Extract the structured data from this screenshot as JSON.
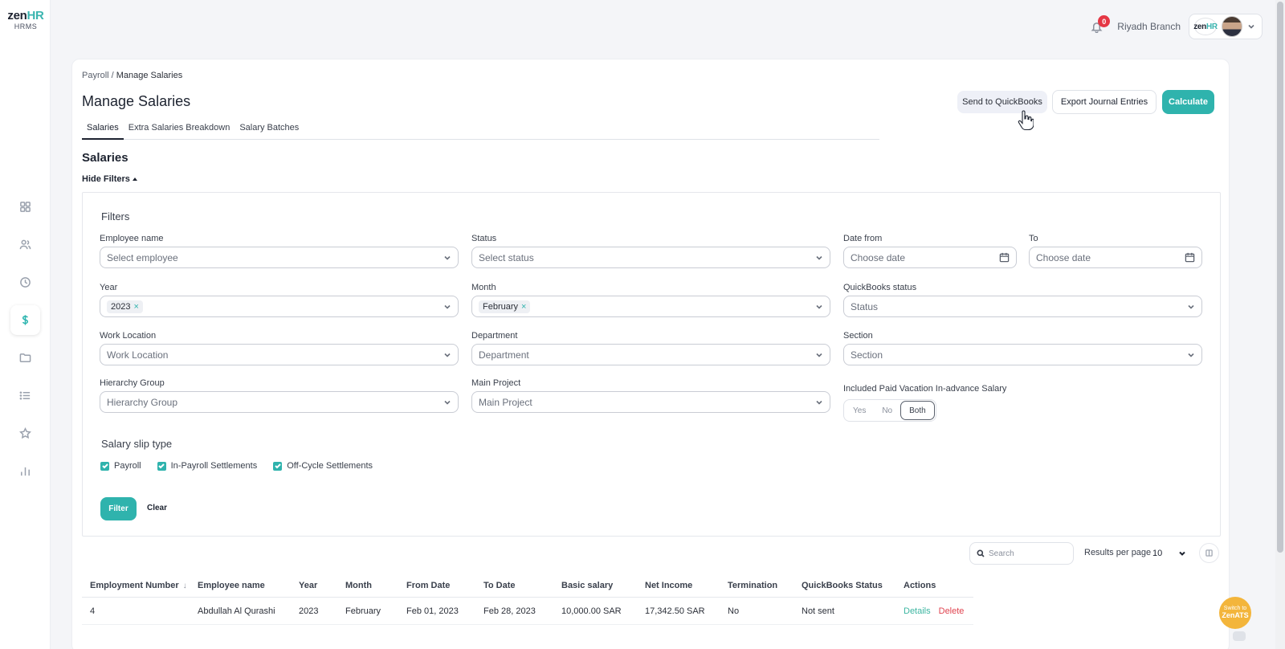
{
  "brand": {
    "logo_main": "zen",
    "logo_accent": "HR",
    "logo_sub": "HRMS"
  },
  "nav": {
    "items": [
      {
        "icon": "dashboard-icon"
      },
      {
        "icon": "people-icon"
      },
      {
        "icon": "clock-icon"
      },
      {
        "icon": "dollar-icon",
        "active": true
      },
      {
        "icon": "folder-icon"
      },
      {
        "icon": "list-icon"
      },
      {
        "icon": "star-icon"
      },
      {
        "icon": "bar-chart-icon"
      }
    ]
  },
  "topbar": {
    "notification_count": "0",
    "branch": "Riyadh Branch",
    "mini_logo_main": "zen",
    "mini_logo_accent": "HR"
  },
  "breadcrumb": {
    "parent": "Payroll",
    "separator": "/",
    "current": "Manage Salaries"
  },
  "page": {
    "title": "Manage Salaries",
    "section_title": "Salaries",
    "hide_filters": "Hide Filters"
  },
  "actions": {
    "send_quickbooks": "Send to QuickBooks",
    "export_journal": "Export Journal Entries",
    "calculate": "Calculate"
  },
  "tabs": [
    {
      "label": "Salaries",
      "active": true
    },
    {
      "label": "Extra Salaries Breakdown",
      "active": false
    },
    {
      "label": "Salary Batches",
      "active": false
    }
  ],
  "filters": {
    "title": "Filters",
    "employee_name": {
      "label": "Employee name",
      "placeholder": "Select employee"
    },
    "status": {
      "label": "Status",
      "placeholder": "Select status"
    },
    "date_from": {
      "label": "Date from",
      "placeholder": "Choose date"
    },
    "date_to": {
      "label": "To",
      "placeholder": "Choose date"
    },
    "year": {
      "label": "Year",
      "value": "2023",
      "remove": "×"
    },
    "month": {
      "label": "Month",
      "value": "February",
      "remove": "×"
    },
    "quickbooks_status": {
      "label": "QuickBooks status",
      "placeholder": "Status"
    },
    "work_location": {
      "label": "Work Location",
      "placeholder": "Work Location"
    },
    "department": {
      "label": "Department",
      "placeholder": "Department"
    },
    "section": {
      "label": "Section",
      "placeholder": "Section"
    },
    "hierarchy_group": {
      "label": "Hierarchy Group",
      "placeholder": "Hierarchy Group"
    },
    "main_project": {
      "label": "Main Project",
      "placeholder": "Main Project"
    },
    "paid_vacation": {
      "label": "Included Paid Vacation In-advance Salary",
      "options": [
        "Yes",
        "No",
        "Both"
      ],
      "selected": "Both"
    },
    "slip_type": {
      "title": "Salary slip type",
      "options": [
        {
          "label": "Payroll",
          "checked": true
        },
        {
          "label": "In-Payroll Settlements",
          "checked": true
        },
        {
          "label": "Off-Cycle Settlements",
          "checked": true
        }
      ]
    },
    "filter_button": "Filter",
    "clear_button": "Clear"
  },
  "table_controls": {
    "search_placeholder": "Search",
    "results_per_page_label": "Results per page",
    "results_per_page_value": "10"
  },
  "table": {
    "columns": [
      "Employment Number",
      "Employee name",
      "Year",
      "Month",
      "From Date",
      "To Date",
      "Basic salary",
      "Net Income",
      "Termination",
      "QuickBooks Status",
      "Actions"
    ],
    "sort_indicator": "↓",
    "rows": [
      {
        "employment_number": "4",
        "employee_name": "Abdullah Al Qurashi",
        "year": "2023",
        "month": "February",
        "from_date": "Feb 01, 2023",
        "to_date": "Feb 28, 2023",
        "basic_salary": "10,000.00 SAR",
        "net_income": "17,342.50 SAR",
        "termination": "No",
        "quickbooks_status": "Not sent",
        "action_details": "Details",
        "action_delete": "Delete"
      }
    ]
  },
  "fab": {
    "line1": "Switch to",
    "line2": "ZenATS"
  },
  "colors": {
    "accent": "#2fb3ad",
    "danger": "#e0434f",
    "fab": "#f3b53b"
  }
}
